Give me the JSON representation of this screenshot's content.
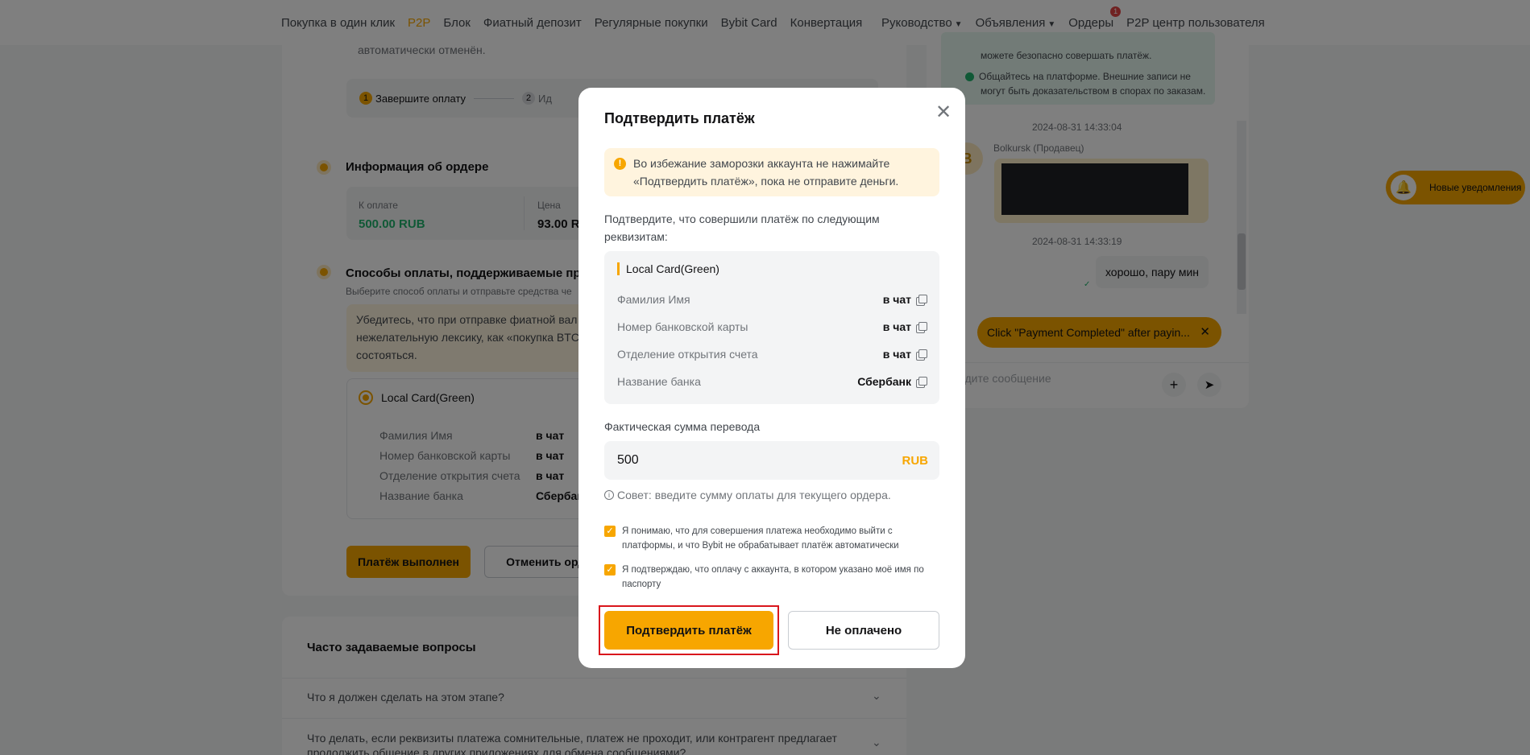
{
  "nav": {
    "left_items": [
      "Покупка в один клик",
      "P2P",
      "Блок",
      "Фиатный депозит",
      "Регулярные покупки",
      "Bybit Card",
      "Конвертация"
    ],
    "active_item": "P2P",
    "right_items": {
      "guide": "Руководство",
      "ads": "Объявления",
      "orders": "Ордеры",
      "orders_badge": "1",
      "user_center": "P2P центр пользователя"
    }
  },
  "order": {
    "cancel_note": "автоматически отменён.",
    "steps": [
      "Завершите оплату",
      "Ид"
    ],
    "step_numbers": [
      "1",
      "2"
    ],
    "info_title": "Информация об ордере",
    "pay_label": "К оплате",
    "pay_value": "500.00 RUB",
    "price_label": "Цена",
    "price_value": "93.00 RUB",
    "methods_title": "Способы оплаты, поддерживаемые прода",
    "methods_sub": "Выберите способ оплаты и отправьте средства че",
    "warning_lines": [
      "Убедитесь, что при отправке фиатной вал",
      "нежелательную лексику, как «покупка BTC",
      "состояться."
    ],
    "method_name": "Local Card(Green)",
    "method_rows": [
      {
        "label": "Фамилия Имя",
        "value": "в чат"
      },
      {
        "label": "Номер банковской карты",
        "value": "в чат"
      },
      {
        "label": "Отделение открытия счета",
        "value": "в чат"
      },
      {
        "label": "Название банка",
        "value": "Сбербанк"
      }
    ],
    "paid_button": "Платёж выполнен",
    "cancel_button": "Отменить орде"
  },
  "faq": {
    "title": "Часто задаваемые вопросы",
    "items": [
      "Что я должен сделать на этом этапе?",
      "Что делать, если реквизиты платежа сомнительные, платеж не проходит, или контрагент предлагает продолжить общение в других приложениях для обмена сообщениями?"
    ]
  },
  "chat": {
    "tips": [
      "можете безопасно совершать платёж.",
      "Общайтесь на платформе. Внешние записи не",
      "могут быть доказательством в спорах по заказам."
    ],
    "time1": "2024-08-31 14:33:04",
    "seller_initial": "B",
    "seller_name": "Bolkursk (Продавец)",
    "time2": "2024-08-31 14:33:19",
    "my_message": "хорошо, пару мин",
    "toast": "Click \"Payment Completed\" after payin...",
    "input_placeholder": "едите сообщение",
    "notify": "Новые уведомления"
  },
  "modal": {
    "title": "Подтвердить платёж",
    "warning": "Во избежание заморозки аккаунта не нажимайте «Подтвердить платёж», пока не отправите деньги.",
    "confirm_text": "Подтвердите, что совершили платёж по следующим реквизитам:",
    "method_name": "Local Card(Green)",
    "rows": [
      {
        "label": "Фамилия Имя",
        "value": "в чат"
      },
      {
        "label": "Номер банковской карты",
        "value": "в чат"
      },
      {
        "label": "Отделение открытия счета",
        "value": "в чат"
      },
      {
        "label": "Название банка",
        "value": "Сбербанк"
      }
    ],
    "amount_label": "Фактическая сумма перевода",
    "amount_value": "500",
    "amount_currency": "RUB",
    "hint": "Совет: введите сумму оплаты для текущего ордера.",
    "check1": "Я понимаю, что для совершения платежа необходимо выйти с платформы, и что Bybit не обрабатывает платёж автоматически",
    "check2": "Я подтверждаю, что оплачу с аккаунта, в котором указано моё имя по паспорту",
    "confirm_button": "Подтвердить платёж",
    "not_paid_button": "Не оплачено"
  }
}
